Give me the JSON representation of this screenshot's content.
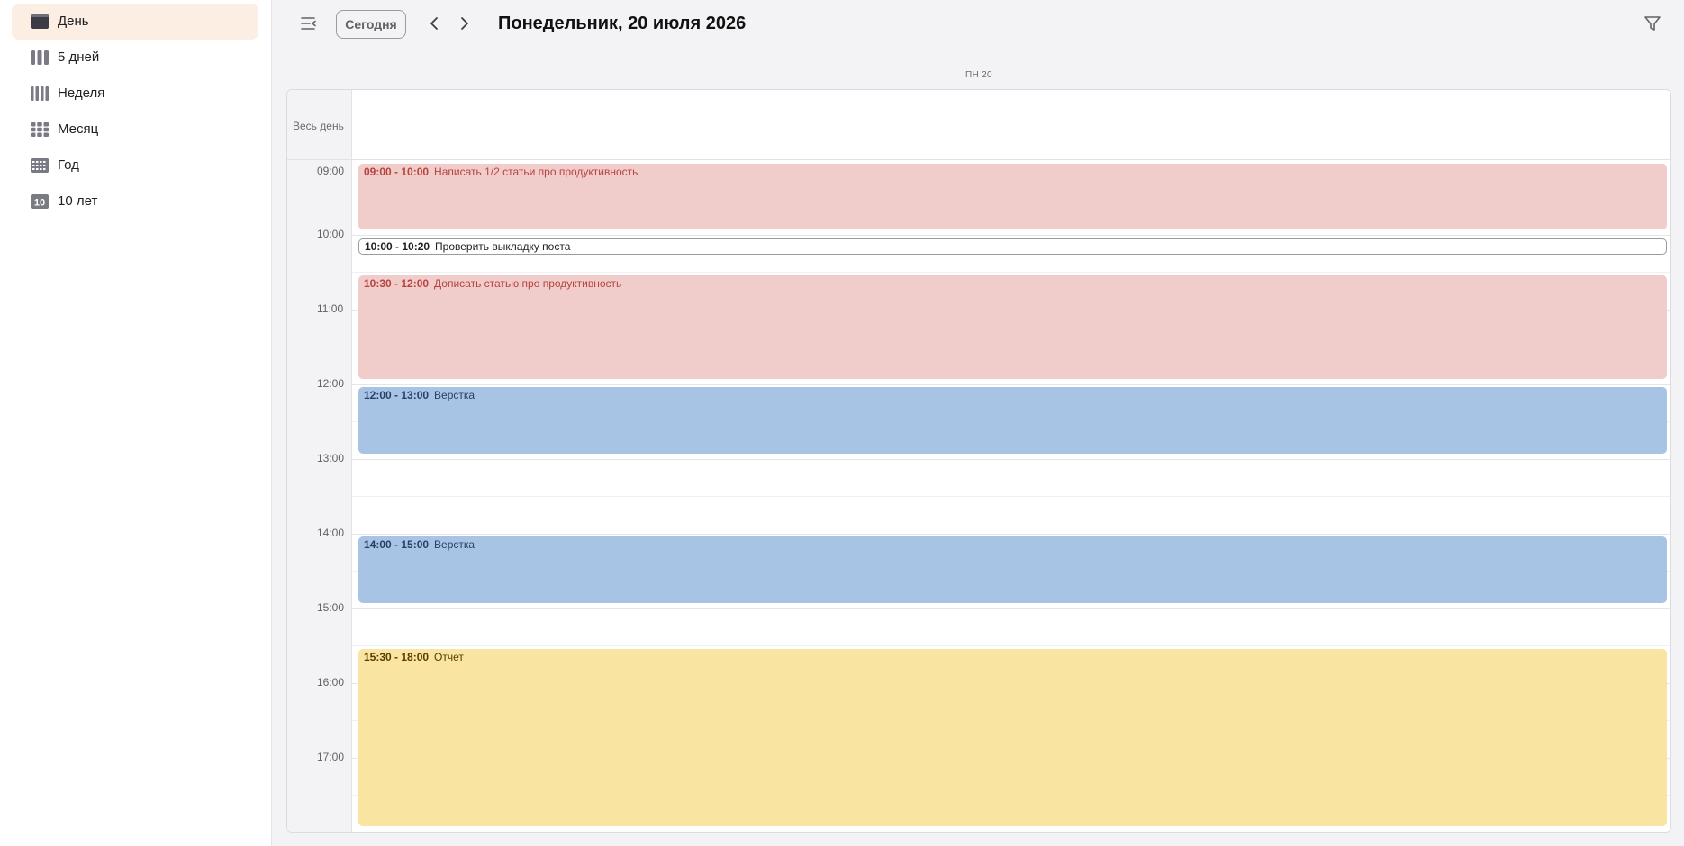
{
  "sidebar": {
    "items": [
      {
        "label": "День",
        "icon": "day-view-icon",
        "active": true
      },
      {
        "label": "5 дней",
        "icon": "five-days-view-icon",
        "active": false
      },
      {
        "label": "Неделя",
        "icon": "week-view-icon",
        "active": false
      },
      {
        "label": "Месяц",
        "icon": "month-view-icon",
        "active": false
      },
      {
        "label": "Год",
        "icon": "year-view-icon",
        "active": false
      },
      {
        "label": "10 лет",
        "icon": "decade-view-icon",
        "icon_text": "10",
        "active": false
      }
    ]
  },
  "header": {
    "today_label": "Сегодня",
    "title": "Понедельник, 20 июля 2026"
  },
  "calendar": {
    "day_header": "ПН 20",
    "all_day_label": "Весь день",
    "hours": [
      "09:00",
      "10:00",
      "11:00",
      "12:00",
      "13:00",
      "14:00",
      "15:00",
      "16:00",
      "17:00"
    ],
    "events": [
      {
        "time": "09:00 - 10:00",
        "title": "Написать 1/2 статьи про продуктивность",
        "color": "#f0cccb"
      },
      {
        "time": "10:00 - 10:20",
        "title": "Проверить выкладку поста",
        "color": "#ffffff"
      },
      {
        "time": "10:30 - 12:00",
        "title": "Дописать статью про продуктивность",
        "color": "#f0cccb"
      },
      {
        "time": "12:00 - 13:00",
        "title": "Верстка",
        "color": "#a8c4e4"
      },
      {
        "time": "14:00 - 15:00",
        "title": "Верстка",
        "color": "#a8c4e4"
      },
      {
        "time": "15:30 - 18:00",
        "title": "Отчет",
        "color": "#f9e4a2"
      }
    ]
  },
  "colors": {
    "accent_active": "#fdeee4",
    "event_red": "#f0cccb",
    "event_blue": "#a8c4e4",
    "event_yellow": "#f9e4a2"
  }
}
